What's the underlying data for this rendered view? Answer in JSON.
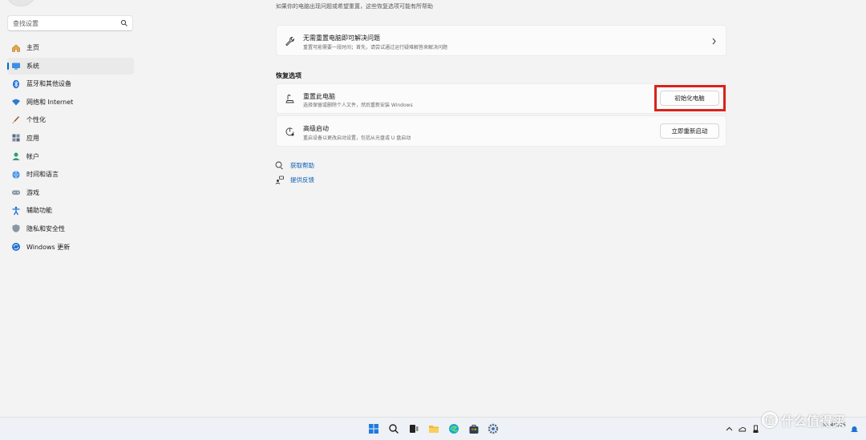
{
  "sidebar": {
    "search_placeholder": "查找设置",
    "items": [
      {
        "label": "主页",
        "icon": "home-icon"
      },
      {
        "label": "系统",
        "icon": "system-icon",
        "active": true
      },
      {
        "label": "蓝牙和其他设备",
        "icon": "bluetooth-icon"
      },
      {
        "label": "网络和 Internet",
        "icon": "wifi-icon"
      },
      {
        "label": "个性化",
        "icon": "brush-icon"
      },
      {
        "label": "应用",
        "icon": "apps-icon"
      },
      {
        "label": "帐户",
        "icon": "account-icon"
      },
      {
        "label": "时间和语言",
        "icon": "globe-clock-icon"
      },
      {
        "label": "游戏",
        "icon": "gamepad-icon"
      },
      {
        "label": "辅助功能",
        "icon": "accessibility-icon"
      },
      {
        "label": "隐私和安全性",
        "icon": "shield-icon"
      },
      {
        "label": "Windows 更新",
        "icon": "windows-update-icon"
      }
    ]
  },
  "main": {
    "top_text": "如果你的电脑出现问题或希望重置，这些恢复选项可能有所帮助",
    "troubleshoot_card": {
      "title": "无需重置电脑即可解决问题",
      "desc": "重置可能需要一段时间；首先，请尝试通过运行疑难解答来解决问题"
    },
    "section_title": "恢复选项",
    "reset_card": {
      "title": "重置此电脑",
      "desc": "选择保留或删除个人文件，然后重新安装 Windows",
      "button": "初始化电脑"
    },
    "advanced_card": {
      "title": "高级启动",
      "desc": "重启设备以更改启动设置，包括从光盘或 U 盘启动",
      "button": "立即重新启动"
    },
    "links": {
      "help": "获取帮助",
      "feedback": "提供反馈"
    }
  },
  "taskbar": {
    "clock_time": "",
    "clock_date": "2024/2/15",
    "watermark": "什么值得买"
  },
  "colors": {
    "accent": "#0067c0",
    "highlight": "#d9231c",
    "link": "#0a5db3"
  }
}
